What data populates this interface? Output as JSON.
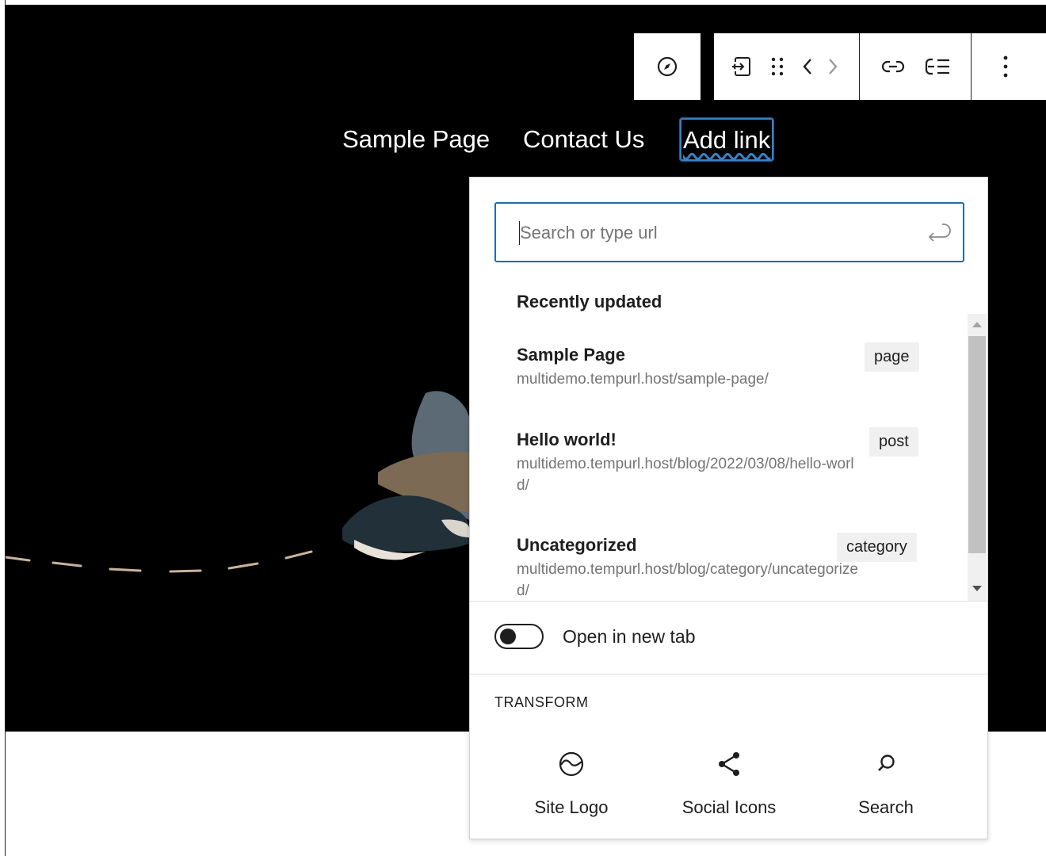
{
  "toolbar": {
    "buttons": [
      {
        "name": "compass-icon"
      },
      {
        "name": "submenu-icon"
      },
      {
        "name": "drag-handle-icon"
      },
      {
        "name": "move-left-icon"
      },
      {
        "name": "move-right-icon"
      },
      {
        "name": "link-icon"
      },
      {
        "name": "add-submenu-icon"
      },
      {
        "name": "more-options-icon"
      }
    ]
  },
  "nav": {
    "items": [
      "Sample Page",
      "Contact Us"
    ],
    "add_link": "Add link"
  },
  "link_popover": {
    "search_placeholder": "Search or type url",
    "recent_title": "Recently updated",
    "results": [
      {
        "title": "Sample Page",
        "url": "multidemo.tempurl.host/sample-page/",
        "type": "page"
      },
      {
        "title": "Hello world!",
        "url": "multidemo.tempurl.host/blog/2022/03/08/hello-world/",
        "type": "post"
      },
      {
        "title": "Uncategorized",
        "url": "multidemo.tempurl.host/blog/category/uncategorized/",
        "type": "category"
      }
    ],
    "new_tab_label": "Open in new tab",
    "new_tab_enabled": false,
    "transform_title": "TRANSFORM",
    "transforms": [
      {
        "label": "Site Logo",
        "icon": "site-logo-icon"
      },
      {
        "label": "Social Icons",
        "icon": "share-icon"
      },
      {
        "label": "Search",
        "icon": "search-icon"
      }
    ]
  },
  "colors": {
    "accent": "#1b6ea8",
    "hero_background": "#000000"
  }
}
